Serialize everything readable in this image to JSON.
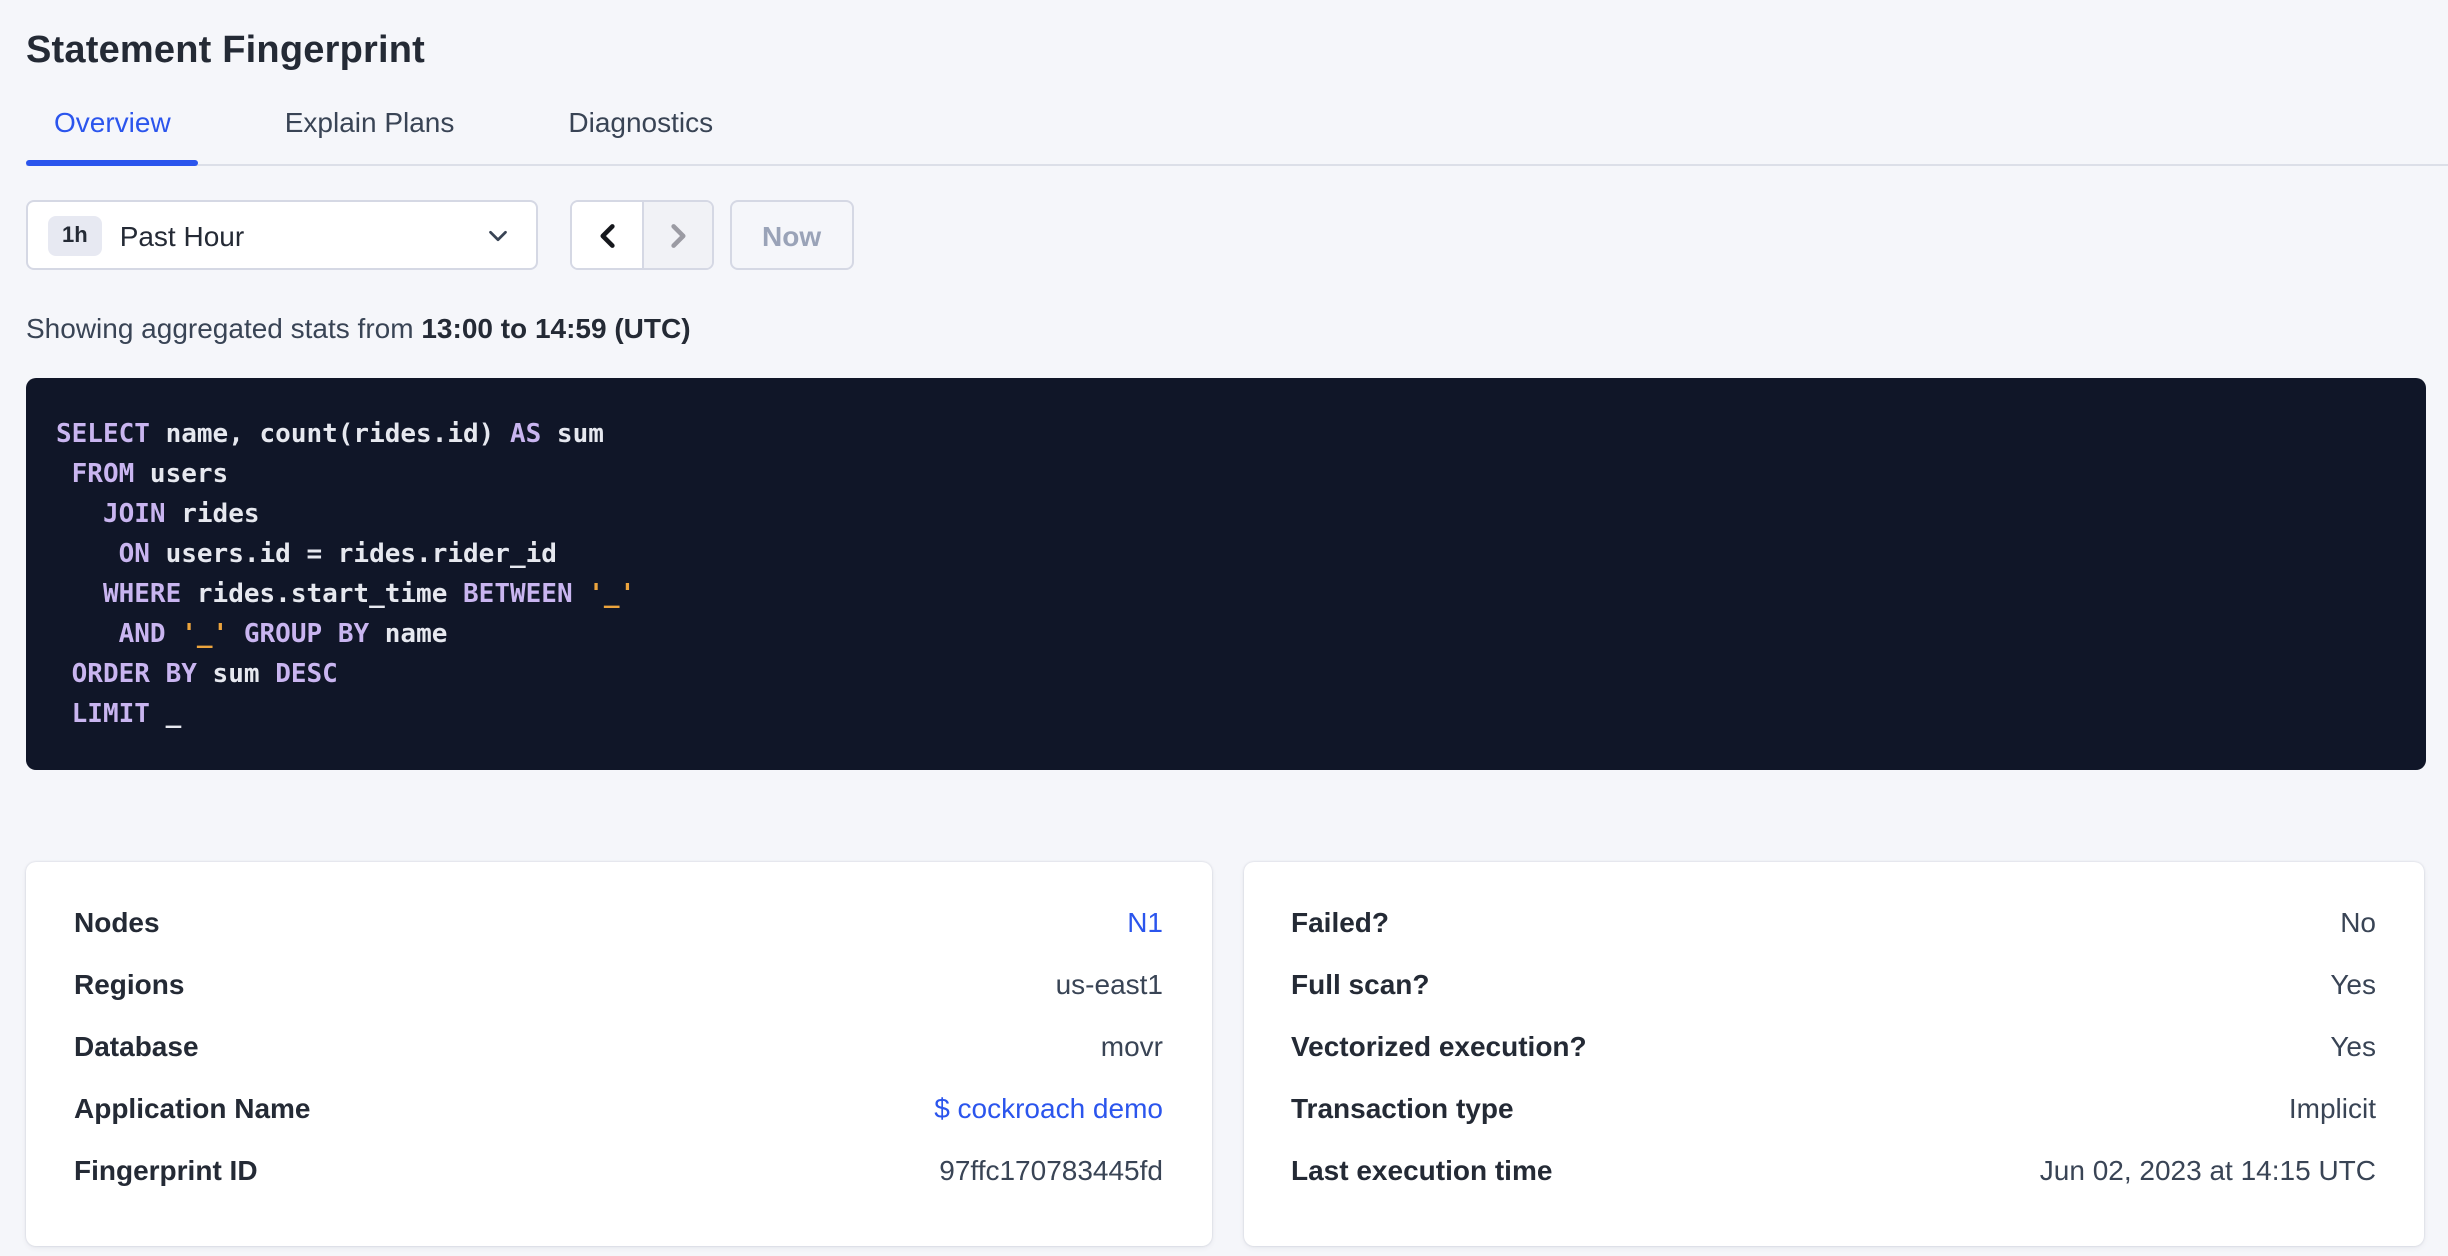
{
  "page": {
    "title": "Statement Fingerprint"
  },
  "tabs": [
    {
      "label": "Overview",
      "active": true
    },
    {
      "label": "Explain Plans",
      "active": false
    },
    {
      "label": "Diagnostics",
      "active": false
    }
  ],
  "time_picker": {
    "badge": "1h",
    "selected": "Past Hour",
    "now_label": "Now",
    "icons": [
      "chevron-down-icon",
      "chevron-left-icon",
      "chevron-right-icon"
    ],
    "prev_enabled": true,
    "next_enabled": false,
    "now_enabled": false
  },
  "stats_caption": {
    "prefix": "Showing aggregated stats from ",
    "range": "13:00 to 14:59 (UTC)"
  },
  "sql": {
    "lines": [
      [
        {
          "c": "kw",
          "t": "SELECT"
        },
        {
          "c": "id",
          "t": " name, count(rides.id) "
        },
        {
          "c": "kw",
          "t": "AS"
        },
        {
          "c": "id",
          "t": " sum"
        }
      ],
      [
        {
          "c": "id",
          "t": " "
        },
        {
          "c": "kw",
          "t": "FROM"
        },
        {
          "c": "id",
          "t": " users"
        }
      ],
      [
        {
          "c": "id",
          "t": "   "
        },
        {
          "c": "kw",
          "t": "JOIN"
        },
        {
          "c": "id",
          "t": " rides"
        }
      ],
      [
        {
          "c": "id",
          "t": "    "
        },
        {
          "c": "kw",
          "t": "ON"
        },
        {
          "c": "id",
          "t": " users.id = rides.rider_id"
        }
      ],
      [
        {
          "c": "id",
          "t": "   "
        },
        {
          "c": "kw",
          "t": "WHERE"
        },
        {
          "c": "id",
          "t": " rides.start_time "
        },
        {
          "c": "kw",
          "t": "BETWEEN"
        },
        {
          "c": "id",
          "t": " "
        },
        {
          "c": "str",
          "t": "'_'"
        }
      ],
      [
        {
          "c": "id",
          "t": "    "
        },
        {
          "c": "kw",
          "t": "AND"
        },
        {
          "c": "id",
          "t": " "
        },
        {
          "c": "str",
          "t": "'_'"
        },
        {
          "c": "id",
          "t": " "
        },
        {
          "c": "kw",
          "t": "GROUP"
        },
        {
          "c": "id",
          "t": " "
        },
        {
          "c": "kw",
          "t": "BY"
        },
        {
          "c": "id",
          "t": " name"
        }
      ],
      [
        {
          "c": "id",
          "t": " "
        },
        {
          "c": "kw",
          "t": "ORDER"
        },
        {
          "c": "id",
          "t": " "
        },
        {
          "c": "kw",
          "t": "BY"
        },
        {
          "c": "id",
          "t": " sum "
        },
        {
          "c": "kw",
          "t": "DESC"
        }
      ],
      [
        {
          "c": "id",
          "t": " "
        },
        {
          "c": "kw",
          "t": "LIMIT"
        },
        {
          "c": "id",
          "t": " _"
        }
      ]
    ]
  },
  "cards": {
    "left": {
      "rows": [
        {
          "label": "Nodes",
          "value": "N1",
          "link": true
        },
        {
          "label": "Regions",
          "value": "us-east1",
          "link": false
        },
        {
          "label": "Database",
          "value": "movr",
          "link": false
        },
        {
          "label": "Application Name",
          "value": "$ cockroach demo",
          "link": true
        },
        {
          "label": "Fingerprint ID",
          "value": "97ffc170783445fd",
          "link": false
        }
      ]
    },
    "right": {
      "rows": [
        {
          "label": "Failed?",
          "value": "No",
          "link": false
        },
        {
          "label": "Full scan?",
          "value": "Yes",
          "link": false
        },
        {
          "label": "Vectorized execution?",
          "value": "Yes",
          "link": false
        },
        {
          "label": "Transaction type",
          "value": "Implicit",
          "link": false
        },
        {
          "label": "Last execution time",
          "value": "Jun 02, 2023 at 14:15 UTC",
          "link": false
        }
      ]
    }
  },
  "colors": {
    "accent_blue": "#2b55ed",
    "page_background": "#f5f6fa",
    "code_background": "#101628",
    "code_keyword": "#c9b5f0",
    "code_identifier": "#e6e8ef",
    "code_string": "#eca43d",
    "heading_text": "#242a35"
  }
}
